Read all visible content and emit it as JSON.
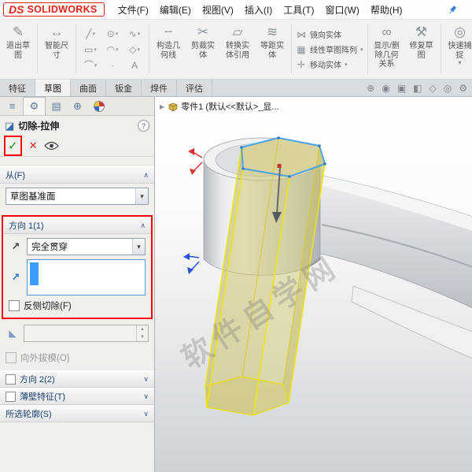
{
  "titlebar": {
    "logo": {
      "ds": "DS",
      "text": "SOLIDWORKS"
    },
    "menus": [
      "文件(F)",
      "编辑(E)",
      "视图(V)",
      "插入(I)",
      "工具(T)",
      "窗口(W)",
      "帮助(H)"
    ]
  },
  "ribbon": {
    "exit_sketch": "退出草\n图",
    "smart_dimension": "智能尺\n寸",
    "construction_geometry": "构造几\n何线",
    "trim": "剪裁实\n体",
    "convert": "转换实\n体引用",
    "offset": "等距实\n体",
    "mirror": "镜向实体",
    "linear_pattern": "线性草图阵列",
    "move": "移动实体",
    "relations": "显示/删\n除几何\n关系",
    "repair": "修复草\n图",
    "quick_snaps": "快速捕\n捉",
    "sketch_glyphs": [
      "╱",
      "⊙",
      "∿",
      "▭",
      "◠",
      "◇",
      "⌒",
      "∙",
      "A"
    ],
    "headsup_glyphs": [
      "⊕",
      "◉",
      "▣",
      "◧",
      "◇",
      "◎",
      "⚙"
    ]
  },
  "tabs": [
    "特征",
    "草图",
    "曲面",
    "钣金",
    "焊件",
    "评估"
  ],
  "panel": {
    "tab_glyphs": [
      "≡",
      "⚙",
      "▤",
      "⊕"
    ],
    "title": "切除-拉伸",
    "help": "?",
    "from": {
      "header": "从(F)",
      "value": "草图基准面"
    },
    "dir1": {
      "header": "方向 1(1)",
      "end_condition": "完全贯穿",
      "flip": "反侧切除(F)",
      "draft_out": "向外拔模(O)"
    },
    "dir2": {
      "header": "方向 2(2)"
    },
    "thin": {
      "header": "薄壁特征(T)"
    },
    "contours": {
      "header": "所选轮廓(S)"
    }
  },
  "viewport": {
    "breadcrumb": "零件1 (默认<<默认>_显...",
    "watermark": "软件自学网"
  },
  "colors": {
    "logo_red": "#e2231a",
    "annotation_red": "#ff0000",
    "ok_green": "#139a13",
    "cancel_red": "#cc2222",
    "selection_blue": "#3d9bfc",
    "preview_yellow": "#f0e600",
    "sketch_blue": "#4da3e8"
  }
}
